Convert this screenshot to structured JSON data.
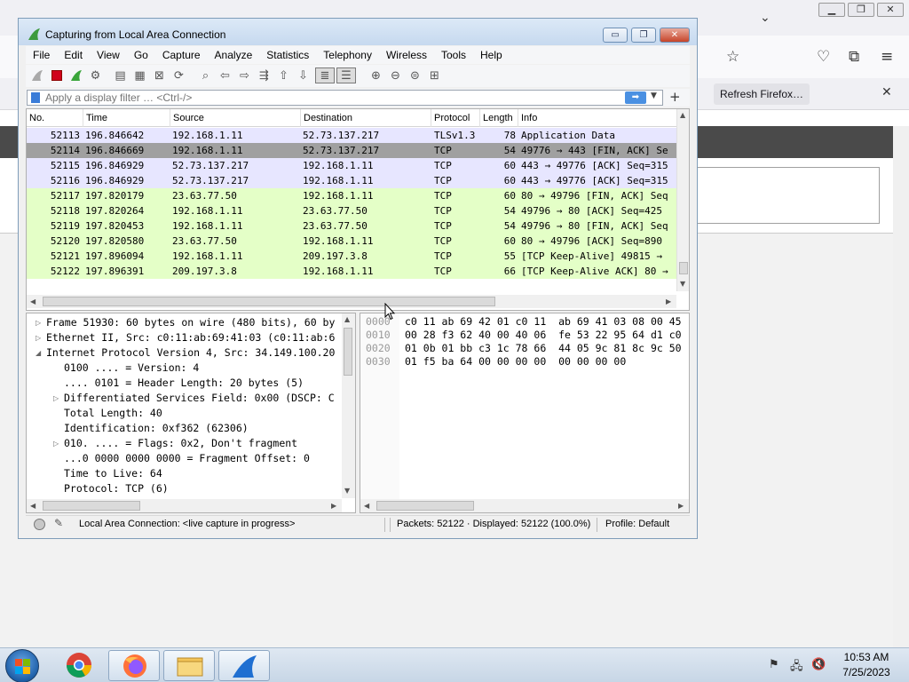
{
  "window": {
    "title": "Capturing from Local Area Connection",
    "controls": {
      "minimize": "▭",
      "maximize": "❐",
      "close": "✕"
    }
  },
  "menu": [
    "File",
    "Edit",
    "View",
    "Go",
    "Capture",
    "Analyze",
    "Statistics",
    "Telephony",
    "Wireless",
    "Tools",
    "Help"
  ],
  "filter": {
    "placeholder": "Apply a display filter … <Ctrl-/>",
    "value": ""
  },
  "packet_list": {
    "columns": [
      "No.",
      "Time",
      "Source",
      "Destination",
      "Protocol",
      "Length",
      "Info"
    ],
    "rows": [
      {
        "no": "52113",
        "time": "196.846642",
        "src": "192.168.1.11",
        "dst": "52.73.137.217",
        "proto": "TLSv1.3",
        "len": "78",
        "info": "Application Data",
        "color": "#e7e6ff"
      },
      {
        "no": "52114",
        "time": "196.846669",
        "src": "192.168.1.11",
        "dst": "52.73.137.217",
        "proto": "TCP",
        "len": "54",
        "info": "49776 → 443 [FIN, ACK] Se",
        "color": "#a0a0a0"
      },
      {
        "no": "52115",
        "time": "196.846929",
        "src": "52.73.137.217",
        "dst": "192.168.1.11",
        "proto": "TCP",
        "len": "60",
        "info": "443 → 49776 [ACK] Seq=315",
        "color": "#e7e6ff"
      },
      {
        "no": "52116",
        "time": "196.846929",
        "src": "52.73.137.217",
        "dst": "192.168.1.11",
        "proto": "TCP",
        "len": "60",
        "info": "443 → 49776 [ACK] Seq=315",
        "color": "#e7e6ff"
      },
      {
        "no": "52117",
        "time": "197.820179",
        "src": "23.63.77.50",
        "dst": "192.168.1.11",
        "proto": "TCP",
        "len": "60",
        "info": "80 → 49796 [FIN, ACK] Seq",
        "color": "#e4ffc7"
      },
      {
        "no": "52118",
        "time": "197.820264",
        "src": "192.168.1.11",
        "dst": "23.63.77.50",
        "proto": "TCP",
        "len": "54",
        "info": "49796 → 80 [ACK] Seq=425",
        "color": "#e4ffc7"
      },
      {
        "no": "52119",
        "time": "197.820453",
        "src": "192.168.1.11",
        "dst": "23.63.77.50",
        "proto": "TCP",
        "len": "54",
        "info": "49796 → 80 [FIN, ACK] Seq",
        "color": "#e4ffc7"
      },
      {
        "no": "52120",
        "time": "197.820580",
        "src": "23.63.77.50",
        "dst": "192.168.1.11",
        "proto": "TCP",
        "len": "60",
        "info": "80 → 49796 [ACK] Seq=890",
        "color": "#e4ffc7"
      },
      {
        "no": "52121",
        "time": "197.896094",
        "src": "192.168.1.11",
        "dst": "209.197.3.8",
        "proto": "TCP",
        "len": "55",
        "info": "[TCP Keep-Alive] 49815 →",
        "color": "#e4ffc7"
      },
      {
        "no": "52122",
        "time": "197.896391",
        "src": "209.197.3.8",
        "dst": "192.168.1.11",
        "proto": "TCP",
        "len": "66",
        "info": "[TCP Keep-Alive ACK] 80 →",
        "color": "#e4ffc7"
      }
    ]
  },
  "details": [
    {
      "text": "Frame 51930: 60 bytes on wire (480 bits), 60 by",
      "indent": 0,
      "expander": "collapsed"
    },
    {
      "text": "Ethernet II, Src: c0:11:ab:69:41:03 (c0:11:ab:6",
      "indent": 0,
      "expander": "collapsed"
    },
    {
      "text": "Internet Protocol Version 4, Src: 34.149.100.20",
      "indent": 0,
      "expander": "expanded"
    },
    {
      "text": "0100 .... = Version: 4",
      "indent": 1,
      "expander": "none"
    },
    {
      "text": ".... 0101 = Header Length: 20 bytes (5)",
      "indent": 1,
      "expander": "none"
    },
    {
      "text": "Differentiated Services Field: 0x00 (DSCP: C",
      "indent": 1,
      "expander": "collapsed"
    },
    {
      "text": "Total Length: 40",
      "indent": 1,
      "expander": "none"
    },
    {
      "text": "Identification: 0xf362 (62306)",
      "indent": 1,
      "expander": "none"
    },
    {
      "text": "010. .... = Flags: 0x2, Don't fragment",
      "indent": 1,
      "expander": "collapsed"
    },
    {
      "text": "...0 0000 0000 0000 = Fragment Offset: 0",
      "indent": 1,
      "expander": "none"
    },
    {
      "text": "Time to Live: 64",
      "indent": 1,
      "expander": "none"
    },
    {
      "text": "Protocol: TCP (6)",
      "indent": 1,
      "expander": "none"
    }
  ],
  "bytes": [
    {
      "offset": "0000",
      "hex": "c0 11 ab 69 42 01 c0 11  ab 69 41 03 08 00 45"
    },
    {
      "offset": "0010",
      "hex": "00 28 f3 62 40 00 40 06  fe 53 22 95 64 d1 c0"
    },
    {
      "offset": "0020",
      "hex": "01 0b 01 bb c3 1c 78 66  44 05 9c 81 8c 9c 50"
    },
    {
      "offset": "0030",
      "hex": "01 f5 ba 64 00 00 00 00  00 00 00 00"
    }
  ],
  "status": {
    "text": "Local Area Connection: <live capture in progress>",
    "packets": "Packets: 52122 · Displayed: 52122 (100.0%)",
    "profile": "Profile: Default"
  },
  "firefox": {
    "refresh_label": "Refresh Firefox…"
  },
  "clock": {
    "time": "10:53 AM",
    "date": "7/25/2023"
  },
  "icons": {
    "bookmark_filter": "bookmark-icon",
    "apply_filter": "arrow-right-icon",
    "start": "windows-logo-icon"
  }
}
